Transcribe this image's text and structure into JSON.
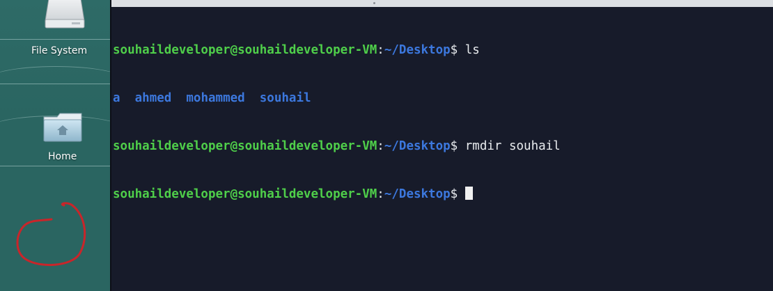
{
  "desktop": {
    "icons": [
      {
        "label": "File System",
        "icon": "hard-drive-icon"
      },
      {
        "label": "Home",
        "icon": "home-folder-icon"
      }
    ]
  },
  "terminal": {
    "prompt": {
      "user_host": "souhaildeveloper@souhaildeveloper-VM",
      "colon": ":",
      "path": "~/Desktop",
      "symbol": "$"
    },
    "lines": [
      {
        "type": "command",
        "command": " ls"
      },
      {
        "type": "output",
        "items": [
          "a",
          "ahmed",
          "mohammed",
          "souhail"
        ]
      },
      {
        "type": "command",
        "command": " rmdir souhail"
      },
      {
        "type": "command",
        "command": " "
      }
    ]
  },
  "colors": {
    "prompt_user": "#4fcf4a",
    "prompt_path": "#3c78de",
    "terminal_bg": "#171b2a",
    "desktop_bg": "#2f6f69",
    "annotation": "#c9252a"
  }
}
